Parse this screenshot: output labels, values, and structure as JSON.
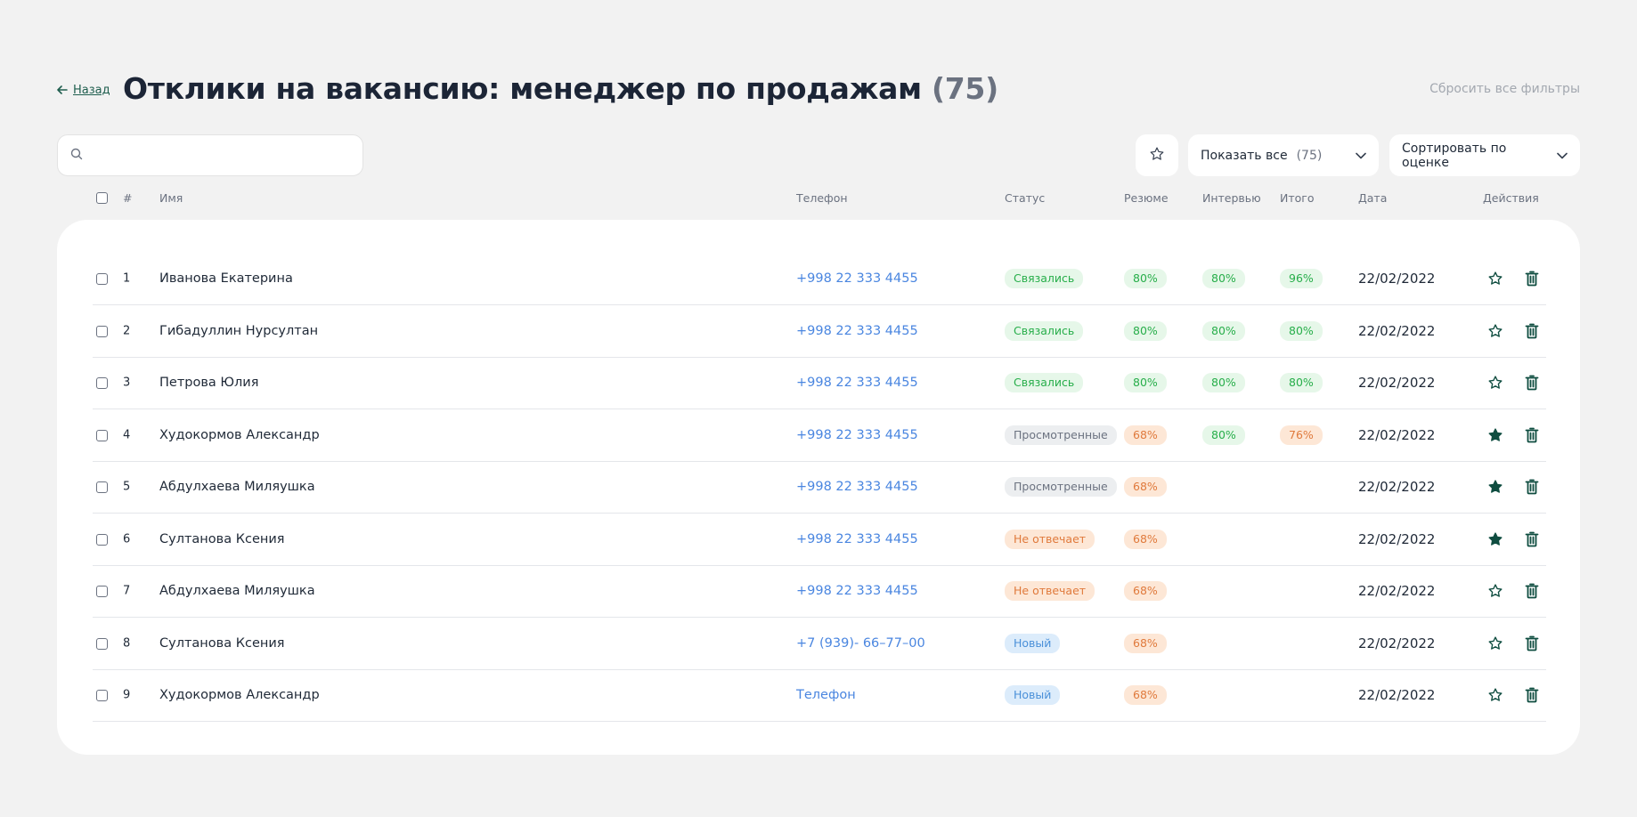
{
  "page": {
    "back_label": "Назад",
    "title": "Отклики на вакансию: менеджер по продажам",
    "title_count": "(75)",
    "reset_filters": "Сбросить все фильтры"
  },
  "toolbar": {
    "search_value": "",
    "search_placeholder": "",
    "show_label": "Показать все",
    "show_count": "(75)",
    "sort_label": "Сортировать по оценке"
  },
  "table": {
    "headers": {
      "num": "#",
      "name": "Имя",
      "phone": "Телефон",
      "status": "Статус",
      "resume": "Резюме",
      "interview": "Интервью",
      "total": "Итого",
      "date": "Дата",
      "actions": "Действия"
    },
    "rows": [
      {
        "num": "1",
        "name": "Иванова Екатерина",
        "phone": "+998 22 333 4455",
        "status": "Связались",
        "status_kind": "green",
        "resume": "80%",
        "resume_kind": "green",
        "interview": "80%",
        "interview_kind": "green",
        "total": "96%",
        "total_kind": "green",
        "date": "22/02/2022",
        "favorite": false
      },
      {
        "num": "2",
        "name": "Гибадуллин Нурсултан",
        "phone": "+998 22 333 4455",
        "status": "Связались",
        "status_kind": "green",
        "resume": "80%",
        "resume_kind": "green",
        "interview": "80%",
        "interview_kind": "green",
        "total": "80%",
        "total_kind": "green",
        "date": "22/02/2022",
        "favorite": false
      },
      {
        "num": "3",
        "name": "Петрова Юлия",
        "phone": "+998 22 333 4455",
        "status": "Связались",
        "status_kind": "green",
        "resume": "80%",
        "resume_kind": "green",
        "interview": "80%",
        "interview_kind": "green",
        "total": "80%",
        "total_kind": "green",
        "date": "22/02/2022",
        "favorite": false
      },
      {
        "num": "4",
        "name": "Худокормов Александр",
        "phone": "+998 22 333 4455",
        "status": "Просмотренные",
        "status_kind": "gray",
        "resume": "68%",
        "resume_kind": "orange",
        "interview": "80%",
        "interview_kind": "green",
        "total": "76%",
        "total_kind": "orange",
        "date": "22/02/2022",
        "favorite": true
      },
      {
        "num": "5",
        "name": "Абдулхаева Миляушка",
        "phone": "+998 22 333 4455",
        "status": "Просмотренные",
        "status_kind": "gray",
        "resume": "68%",
        "resume_kind": "orange",
        "interview": "",
        "interview_kind": "",
        "total": "",
        "total_kind": "",
        "date": "22/02/2022",
        "favorite": true
      },
      {
        "num": "6",
        "name": "Султанова Ксения",
        "phone": "+998 22 333 4455",
        "status": "Не отвечает",
        "status_kind": "orange",
        "resume": "68%",
        "resume_kind": "orange",
        "interview": "",
        "interview_kind": "",
        "total": "",
        "total_kind": "",
        "date": "22/02/2022",
        "favorite": true
      },
      {
        "num": "7",
        "name": "Абдулхаева Миляушка",
        "phone": "+998 22 333 4455",
        "status": "Не отвечает",
        "status_kind": "orange",
        "resume": "68%",
        "resume_kind": "orange",
        "interview": "",
        "interview_kind": "",
        "total": "",
        "total_kind": "",
        "date": "22/02/2022",
        "favorite": false
      },
      {
        "num": "8",
        "name": "Султанова Ксения",
        "phone": "+7 (939)- 66–77–00",
        "status": "Новый",
        "status_kind": "blue",
        "resume": "68%",
        "resume_kind": "orange",
        "interview": "",
        "interview_kind": "",
        "total": "",
        "total_kind": "",
        "date": "22/02/2022",
        "favorite": false
      },
      {
        "num": "9",
        "name": "Худокормов Александр",
        "phone": "Телефон",
        "status": "Новый",
        "status_kind": "blue",
        "resume": "68%",
        "resume_kind": "orange",
        "interview": "",
        "interview_kind": "",
        "total": "",
        "total_kind": "",
        "date": "22/02/2022",
        "favorite": false
      }
    ]
  },
  "colors": {
    "accent": "#0f4d40",
    "link": "#4a86e0",
    "green_bg": "#e6f7e9",
    "green_fg": "#27ae4a",
    "orange_bg": "#fde7d6",
    "orange_fg": "#e07a3c",
    "gray_bg": "#eceef0",
    "gray_fg": "#6b7280",
    "blue_bg": "#dcecfb",
    "blue_fg": "#4a90d9"
  },
  "icons": {
    "back": "arrow-left-icon",
    "search": "search-icon",
    "star": "star-icon",
    "chevron": "chevron-down-icon",
    "delete": "trash-icon"
  }
}
